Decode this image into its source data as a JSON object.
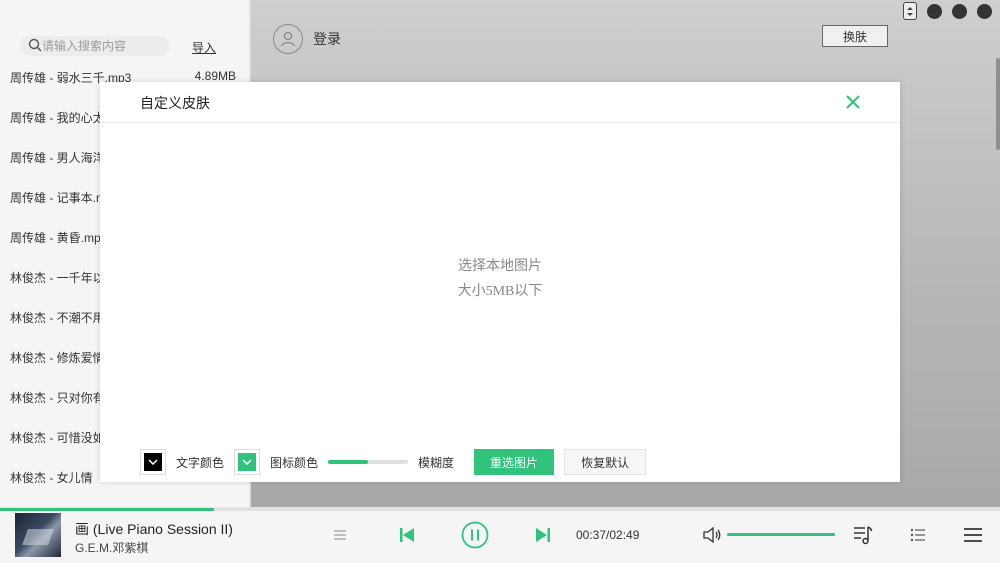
{
  "sidebar": {
    "search_placeholder": "请输入搜索内容",
    "import_label": "导入",
    "songs": [
      {
        "name": "周传雄 - 弱水三千.mp3",
        "size": "4.89MB"
      },
      {
        "name": "周传雄 - 我的心太",
        "size": ""
      },
      {
        "name": "周传雄 - 男人海洋",
        "size": ""
      },
      {
        "name": "周传雄 - 记事本.m",
        "size": ""
      },
      {
        "name": "周传雄 - 黄昏.mp",
        "size": ""
      },
      {
        "name": "林俊杰 - 一千年以",
        "size": ""
      },
      {
        "name": "林俊杰 - 不潮不用",
        "size": ""
      },
      {
        "name": "林俊杰 - 修炼爱情",
        "size": ""
      },
      {
        "name": "林俊杰 - 只对你有",
        "size": ""
      },
      {
        "name": "林俊杰 - 可惜没如",
        "size": ""
      },
      {
        "name": "林俊杰 - 女儿情",
        "size": ""
      }
    ]
  },
  "header": {
    "login_label": "登录",
    "skin_button_label": "换肤"
  },
  "modal": {
    "title": "自定义皮肤",
    "upload_line1": "选择本地图片",
    "upload_line2": "大小5MB以下",
    "text_color_label": "文字颜色",
    "icon_color_label": "图标颜色",
    "blur_label": "模糊度",
    "blur_level": 0.5,
    "reselect_button": "重选图片",
    "restore_button": "恢复默认",
    "text_color": "#000000",
    "icon_color": "#31c27c"
  },
  "player": {
    "title": "画 (Live Piano Session II)",
    "artist": "G.E.M.邓紫棋",
    "time": "00:37/02:49",
    "progress": 0.214,
    "volume": 1.0
  },
  "colors": {
    "accent": "#31c27c",
    "sidebar_bg": "#f5f5f5",
    "modal_bg": "#ffffff"
  },
  "icons": {
    "search": "search-icon",
    "close": "close-icon",
    "avatar": "user-icon",
    "prev": "skip-back-icon",
    "pause": "pause-icon",
    "next": "skip-forward-icon",
    "volume": "volume-icon",
    "lyrics": "lyrics-icon",
    "playlist": "playlist-icon",
    "menu": "menu-icon"
  }
}
